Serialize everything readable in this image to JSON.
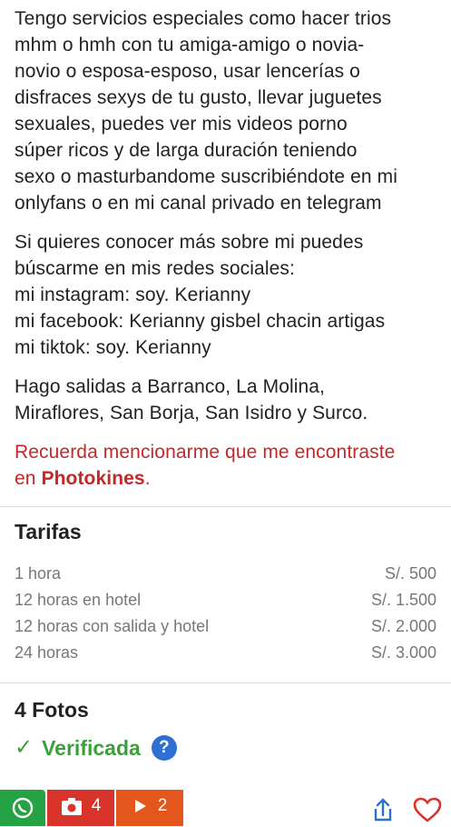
{
  "description": {
    "paragraph1": [
      "Tengo servicios especiales como hacer trios",
      "mhm o hmh con tu amiga-amigo o novia-",
      "novio o esposa-esposo, usar lencerías o",
      "disfraces sexys de tu gusto, llevar juguetes",
      "sexuales, puedes ver mis videos porno",
      "súper ricos y de larga duración teniendo",
      "sexo o masturbandome suscribiéndote en mi",
      "onlyfans o en mi canal privado en telegram"
    ],
    "paragraph2": [
      "Si quieres conocer más sobre mi puedes",
      "búscarme en mis redes sociales:",
      "mi instagram: soy. Kerianny",
      "mi facebook: Kerianny gisbel chacin artigas",
      "mi tiktok: soy. Kerianny"
    ],
    "paragraph3": [
      "Hago salidas a Barranco, La Molina,",
      "Miraflores, San Borja, San Isidro y Surco."
    ],
    "notice": {
      "line1": "Recuerda mencionarme que me encontraste",
      "prefix": "en ",
      "brand": "Photokines",
      "suffix": "."
    }
  },
  "rates": {
    "title": "Tarifas",
    "rows": [
      {
        "label": "1 hora",
        "price": "S/. 500"
      },
      {
        "label": "12 horas en hotel",
        "price": "S/. 1.500"
      },
      {
        "label": "12 horas con salida y hotel",
        "price": "S/. 2.000"
      },
      {
        "label": "24 horas",
        "price": "S/. 3.000"
      }
    ]
  },
  "photos": {
    "title": "4 Fotos",
    "verified_label": "Verificada",
    "help_glyph": "?"
  },
  "bottom_bar": {
    "photo_count": "4",
    "video_count": "2"
  },
  "colors": {
    "notice_red": "#c62828",
    "verified_green": "#3aa03a",
    "whatsapp_green": "#25a244",
    "photo_red": "#d8342c",
    "video_orange": "#e4571c",
    "help_blue": "#2f6fd1"
  },
  "icons": {
    "whatsapp": "whatsapp-icon",
    "camera": "camera-icon",
    "play": "play-icon",
    "share": "share-icon",
    "favorite": "heart-icon",
    "check": "check-icon",
    "help": "help-icon"
  }
}
